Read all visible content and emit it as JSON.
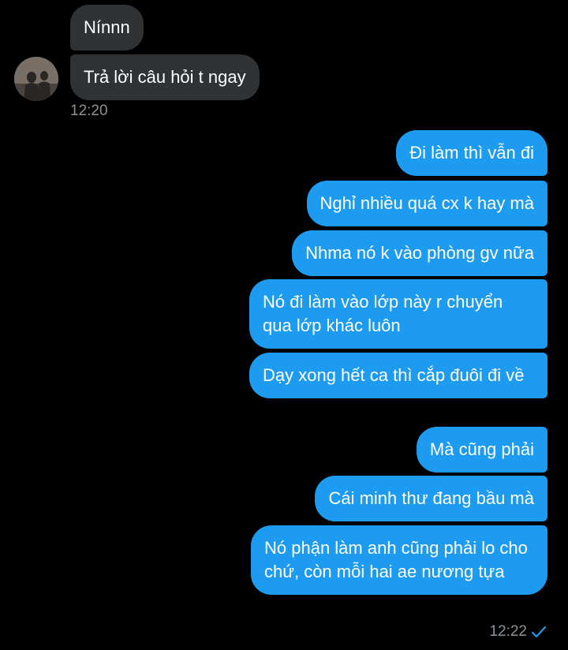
{
  "incoming": {
    "messages": [
      "Nínnn",
      "Trả lời câu hỏi t ngay"
    ],
    "time": "12:20"
  },
  "outgoing": {
    "messages": [
      "Đi làm thì vẫn đi",
      "Nghỉ nhiều quá cx k hay mà",
      "Nhma nó k vào phòng gv nữa",
      "Nó đi làm vào lớp này r chuyển qua lớp khác luôn",
      "Dạy xong hết ca thì cắp đuôi đi về",
      "Mà cũng phải",
      "Cái minh thư đang bầu mà",
      "Nó phận làm anh cũng phải lo cho chứ, còn mỗi hai ae nương tựa"
    ],
    "time": "12:22",
    "status_icon": "read-check-icon"
  },
  "colors": {
    "background": "#000000",
    "incoming_bubble": "#2f3336",
    "outgoing_bubble": "#1d9bf0",
    "timestamp": "#8b9298"
  }
}
